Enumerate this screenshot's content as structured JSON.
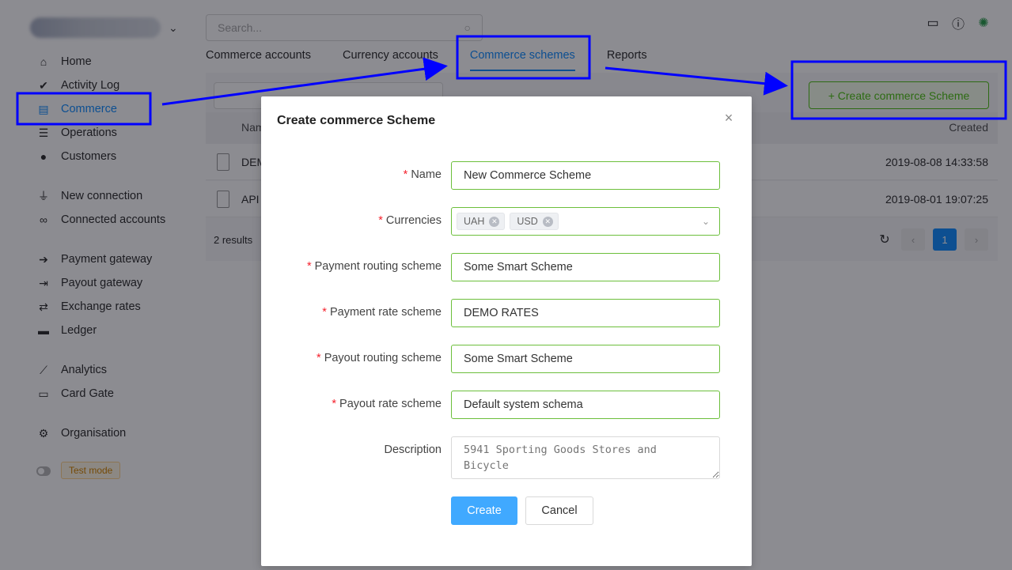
{
  "account": {
    "chevron_icon": "chevron-down"
  },
  "sidebar": {
    "items": [
      {
        "label": "Home",
        "icon": "home-icon"
      },
      {
        "label": "Activity Log",
        "icon": "checks-icon"
      },
      {
        "label": "Commerce",
        "icon": "shop-icon"
      },
      {
        "label": "Operations",
        "icon": "list-icon"
      },
      {
        "label": "Customers",
        "icon": "users-icon"
      },
      {
        "label": "New connection",
        "icon": "plug-icon"
      },
      {
        "label": "Connected accounts",
        "icon": "link-icon"
      },
      {
        "label": "Payment gateway",
        "icon": "sign-in-icon"
      },
      {
        "label": "Payout gateway",
        "icon": "sign-out-icon"
      },
      {
        "label": "Exchange rates",
        "icon": "exchange-icon"
      },
      {
        "label": "Ledger",
        "icon": "ledger-icon"
      },
      {
        "label": "Analytics",
        "icon": "chart-icon"
      },
      {
        "label": "Card Gate",
        "icon": "card-icon"
      },
      {
        "label": "Organisation",
        "icon": "gear-icon"
      }
    ],
    "active_item": "Commerce",
    "test_mode": "Test mode"
  },
  "header": {
    "search_placeholder": "Search...",
    "icons": [
      "message-icon",
      "info-icon",
      "profile-logo-icon"
    ]
  },
  "tabs": [
    {
      "label": "Commerce accounts"
    },
    {
      "label": "Currency accounts"
    },
    {
      "label": "Commerce schemes"
    },
    {
      "label": "Reports"
    }
  ],
  "active_tab": "Commerce schemes",
  "list": {
    "create_button": "+ Create commerce Scheme",
    "col_name": "Nam",
    "col_created": "Created",
    "rows": [
      {
        "name": "DEM",
        "created": "2019-08-08 14:33:58"
      },
      {
        "name": "API",
        "created": "2019-08-01 19:07:25"
      }
    ],
    "results": "2 results",
    "current_page": "1"
  },
  "modal": {
    "title": "Create commerce Scheme",
    "fields": [
      {
        "label": "Name",
        "required": true,
        "value": "New Commerce Scheme"
      },
      {
        "label": "Currencies",
        "required": true,
        "tags": [
          "UAH",
          "USD"
        ]
      },
      {
        "label": "Payment routing scheme",
        "required": true,
        "value": "Some Smart Scheme"
      },
      {
        "label": "Payment rate scheme",
        "required": true,
        "value": "DEMO RATES"
      },
      {
        "label": "Payout routing scheme",
        "required": true,
        "value": "Some Smart Scheme"
      },
      {
        "label": "Payout rate scheme",
        "required": true,
        "value": "Default system schema"
      },
      {
        "label": "Description",
        "required": false,
        "placeholder": "5941 Sporting Goods Stores and Bicycle"
      }
    ],
    "create_label": "Create",
    "cancel_label": "Cancel"
  },
  "colors": {
    "primary": "#1890ff",
    "success": "#52c41a",
    "required": "#f5222d",
    "annotation": "#0000ff"
  }
}
